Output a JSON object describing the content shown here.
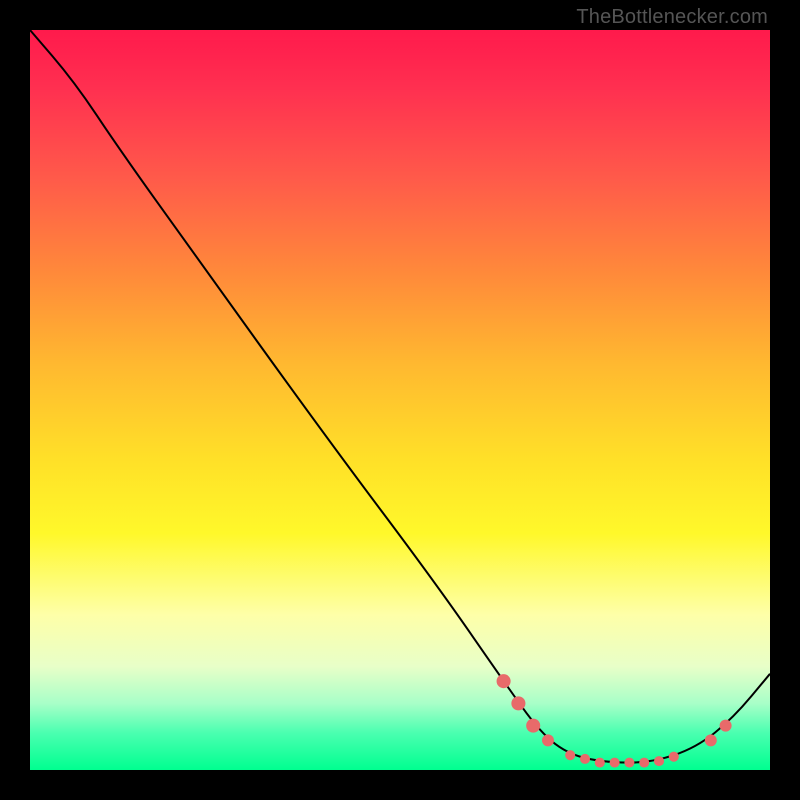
{
  "watermark": "TheBottlenecker.com",
  "chart_data": {
    "type": "line",
    "title": "",
    "xlabel": "",
    "ylabel": "",
    "xlim": [
      0,
      100
    ],
    "ylim": [
      0,
      100
    ],
    "grid": false,
    "legend": false,
    "background_gradient": {
      "direction": "vertical",
      "stops": [
        {
          "pos": 0.0,
          "color": "#ff1a4c"
        },
        {
          "pos": 0.5,
          "color": "#ffd028"
        },
        {
          "pos": 0.78,
          "color": "#feffa8"
        },
        {
          "pos": 1.0,
          "color": "#00ff90"
        }
      ]
    },
    "series": [
      {
        "name": "main-curve",
        "color": "#000000",
        "points": [
          {
            "x": 0,
            "y": 100
          },
          {
            "x": 6,
            "y": 93
          },
          {
            "x": 12,
            "y": 84
          },
          {
            "x": 22,
            "y": 70
          },
          {
            "x": 40,
            "y": 45
          },
          {
            "x": 55,
            "y": 25
          },
          {
            "x": 64,
            "y": 12
          },
          {
            "x": 69,
            "y": 5
          },
          {
            "x": 73,
            "y": 2
          },
          {
            "x": 78,
            "y": 1
          },
          {
            "x": 84,
            "y": 1
          },
          {
            "x": 90,
            "y": 3
          },
          {
            "x": 95,
            "y": 7
          },
          {
            "x": 100,
            "y": 13
          }
        ]
      }
    ],
    "markers": [
      {
        "x": 64,
        "y": 12,
        "color": "#e86a6a",
        "r": 7
      },
      {
        "x": 66,
        "y": 9,
        "color": "#e86a6a",
        "r": 7
      },
      {
        "x": 68,
        "y": 6,
        "color": "#e86a6a",
        "r": 7
      },
      {
        "x": 70,
        "y": 4,
        "color": "#e86a6a",
        "r": 6
      },
      {
        "x": 73,
        "y": 2,
        "color": "#e86a6a",
        "r": 5
      },
      {
        "x": 75,
        "y": 1.5,
        "color": "#e86a6a",
        "r": 5
      },
      {
        "x": 77,
        "y": 1,
        "color": "#e86a6a",
        "r": 5
      },
      {
        "x": 79,
        "y": 1,
        "color": "#e86a6a",
        "r": 5
      },
      {
        "x": 81,
        "y": 1,
        "color": "#e86a6a",
        "r": 5
      },
      {
        "x": 83,
        "y": 1,
        "color": "#e86a6a",
        "r": 5
      },
      {
        "x": 85,
        "y": 1.2,
        "color": "#e86a6a",
        "r": 5
      },
      {
        "x": 87,
        "y": 1.8,
        "color": "#e86a6a",
        "r": 5
      },
      {
        "x": 92,
        "y": 4,
        "color": "#e86a6a",
        "r": 6
      },
      {
        "x": 94,
        "y": 6,
        "color": "#e86a6a",
        "r": 6
      }
    ]
  }
}
